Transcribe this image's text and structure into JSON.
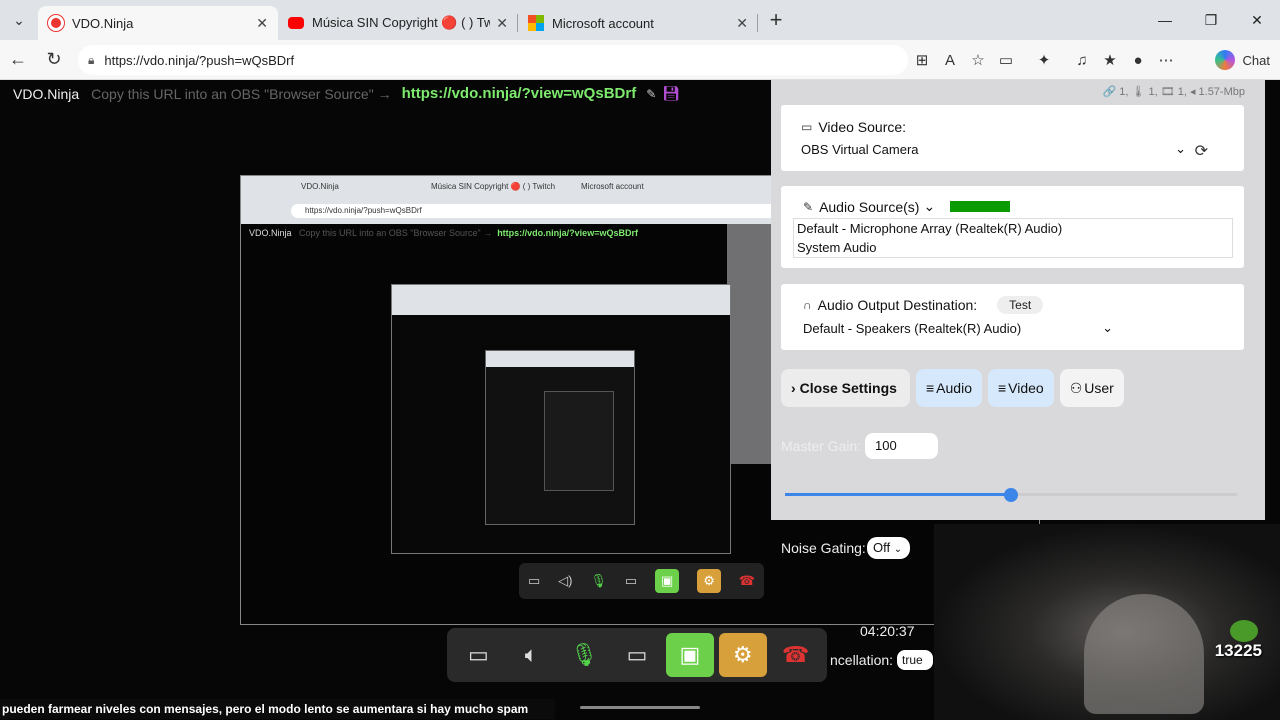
{
  "browser": {
    "tabs": [
      {
        "title": "VDO.Ninja",
        "active": true
      },
      {
        "title": "Música SIN Copyright 🔴 ( ) Twitch",
        "active": false
      },
      {
        "title": "Microsoft account",
        "active": false
      }
    ],
    "url": "https://vdo.ninja/?push=wQsBDrf",
    "chat_label": "Chat"
  },
  "banner": {
    "brand": "VDO.Ninja",
    "hint": "Copy this URL into an OBS \"Browser Source\" →",
    "view_link": "https://vdo.ninja/?view=wQsBDrf"
  },
  "stats": "🔗 1, 🌡 1, 🎞 1, ◂ 1.57-Mbp",
  "settings": {
    "video_source_label": "Video Source:",
    "video_source_value": "OBS Virtual Camera",
    "audio_source_label": "Audio Source(s)",
    "audio_sources": [
      "Default - Microphone Array (Realtek(R) Audio)",
      "System Audio"
    ],
    "audio_output_label": "Audio Output Destination:",
    "test_label": "Test",
    "audio_output_value": "Default - Speakers (Realtek(R) Audio)",
    "buttons": {
      "close": "Close Settings",
      "audio": "Audio",
      "video": "Video",
      "user": "User"
    },
    "master_gain_label": "Master Gain:",
    "master_gain_value": "100",
    "master_gain_fraction": 0.5,
    "noise_gating_label": "Noise Gating:",
    "noise_gating_value": "Off",
    "cancellation_label": "ncellation:",
    "cancellation_value": "true"
  },
  "overlay": {
    "time": "04:20:37",
    "counter": "13225",
    "ticker": "pueden farmear niveles con mensajes, pero el modo lento se aumentara si hay mucho spam"
  },
  "nested": {
    "url": "https://vdo.ninja/?push=wQsBDrf",
    "brand": "VDO.Ninja",
    "hint": "Copy this URL into an OBS \"Browser Source\" →",
    "view_link": "https://vdo.ninja/?view=wQsBDrf"
  },
  "colors": {
    "accent_green": "#6cd04a",
    "link_green": "#7dea6e",
    "settings_gold": "#d8a03a",
    "hangup_red": "#dd3333",
    "slider_blue": "#3b86e8"
  }
}
